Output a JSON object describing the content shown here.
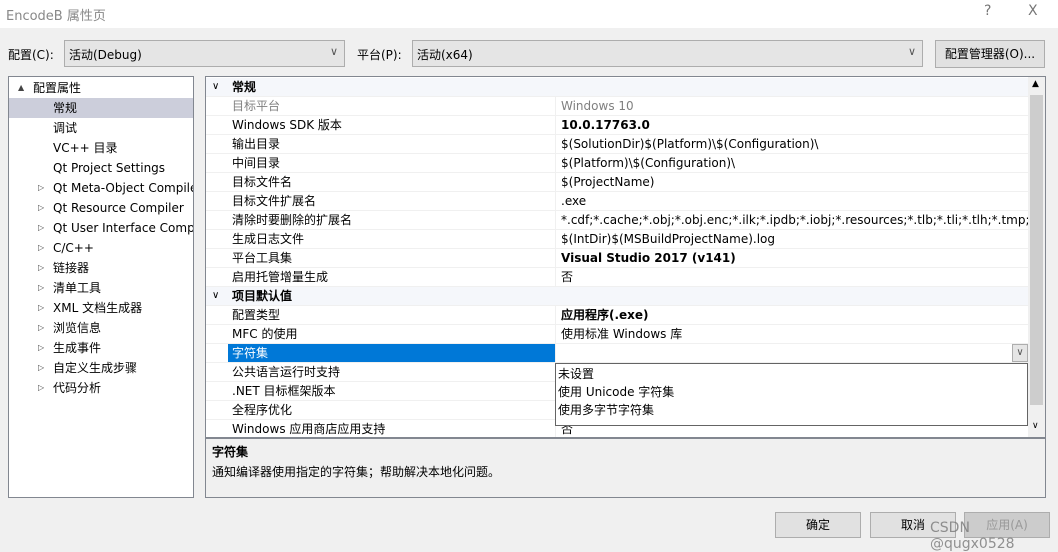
{
  "window": {
    "title": "EncodeB 属性页",
    "help": "?",
    "close": "X"
  },
  "toolbar": {
    "config_label": "配置(C):",
    "config_value": "活动(Debug)",
    "platform_label": "平台(P):",
    "platform_value": "活动(x64)",
    "config_manager": "配置管理器(O)..."
  },
  "tree": {
    "items": [
      {
        "label": "配置属性",
        "expander": "▲"
      },
      {
        "label": "常规",
        "selected": true
      },
      {
        "label": "调试"
      },
      {
        "label": "VC++ 目录"
      },
      {
        "label": "Qt Project Settings"
      },
      {
        "label": "Qt Meta-Object Compiler",
        "expander": "▷"
      },
      {
        "label": "Qt Resource Compiler",
        "expander": "▷"
      },
      {
        "label": "Qt User Interface Compiler",
        "expander": "▷"
      },
      {
        "label": "C/C++",
        "expander": "▷"
      },
      {
        "label": "链接器",
        "expander": "▷"
      },
      {
        "label": "清单工具",
        "expander": "▷"
      },
      {
        "label": "XML 文档生成器",
        "expander": "▷"
      },
      {
        "label": "浏览信息",
        "expander": "▷"
      },
      {
        "label": "生成事件",
        "expander": "▷"
      },
      {
        "label": "自定义生成步骤",
        "expander": "▷"
      },
      {
        "label": "代码分析",
        "expander": "▷"
      }
    ]
  },
  "grid": {
    "rows": [
      {
        "type": "cat",
        "name": "常规"
      },
      {
        "name": "目标平台",
        "value": "Windows 10",
        "dim": true
      },
      {
        "name": "Windows SDK 版本",
        "value": "10.0.17763.0",
        "bold": true
      },
      {
        "name": "输出目录",
        "value": "$(SolutionDir)$(Platform)\\$(Configuration)\\"
      },
      {
        "name": "中间目录",
        "value": "$(Platform)\\$(Configuration)\\"
      },
      {
        "name": "目标文件名",
        "value": "$(ProjectName)"
      },
      {
        "name": "目标文件扩展名",
        "value": ".exe"
      },
      {
        "name": "清除时要删除的扩展名",
        "value": "*.cdf;*.cache;*.obj;*.obj.enc;*.ilk;*.ipdb;*.iobj;*.resources;*.tlb;*.tli;*.tlh;*.tmp;*.rsp;*.p"
      },
      {
        "name": "生成日志文件",
        "value": "$(IntDir)$(MSBuildProjectName).log"
      },
      {
        "name": "平台工具集",
        "value": "Visual Studio 2017 (v141)",
        "bold": true
      },
      {
        "name": "启用托管增量生成",
        "value": "否"
      },
      {
        "type": "cat",
        "name": "项目默认值"
      },
      {
        "name": "配置类型",
        "value": "应用程序(.exe)",
        "bold": true
      },
      {
        "name": "MFC 的使用",
        "value": "使用标准 Windows 库"
      },
      {
        "name": "字符集",
        "value": "",
        "selected": true
      },
      {
        "name": "公共语言运行时支持",
        "value": ""
      },
      {
        "name": ".NET 目标框架版本",
        "value": ""
      },
      {
        "name": "全程序优化",
        "value": ""
      },
      {
        "name": "Windows 应用商店应用支持",
        "value": "否"
      }
    ]
  },
  "dropdown": {
    "options": [
      "未设置",
      "使用 Unicode 字符集",
      "使用多字节字符集"
    ]
  },
  "description": {
    "title": "字符集",
    "text": "通知编译器使用指定的字符集；帮助解决本地化问题。"
  },
  "buttons": {
    "ok": "确定",
    "cancel": "取消",
    "apply": "应用(A)"
  },
  "watermark": "CSDN @qugx0528"
}
